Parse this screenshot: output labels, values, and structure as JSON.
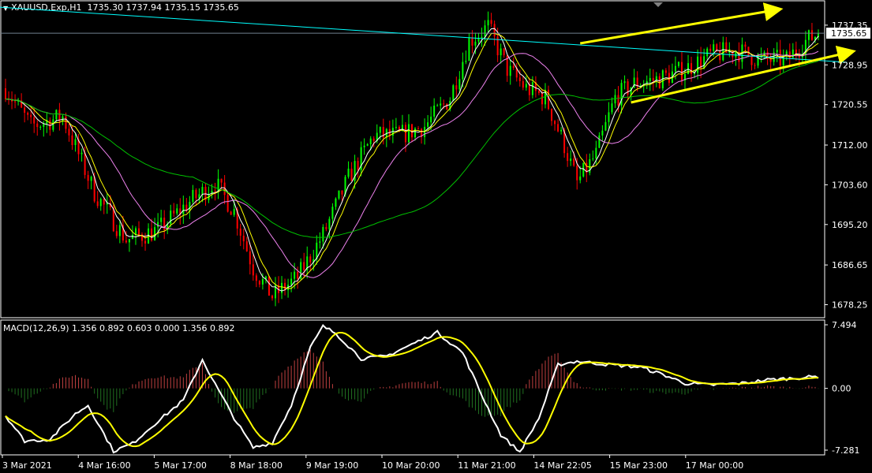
{
  "header": {
    "menu_arrow_icon": "triangle-down-icon",
    "symbol": "XAUUSD.Exp,H1",
    "ohlc": "1735.30 1737.94 1735.15 1735.65"
  },
  "macd": {
    "label": "MACD(12,26,9) 1.356 0.892 0.603 0.000 1.356 0.892"
  },
  "colors": {
    "background": "#000000",
    "frame": "#ffffff",
    "bull_candle": "#00ff00",
    "bear_candle": "#ff0000",
    "ma_fast": "#ffffff",
    "ma_mid": "#ffff00",
    "ma_slow": "#ee82ee",
    "ma_long": "#00c000",
    "trendline": "#00ffff",
    "channel_arrows": "#ffff00",
    "macd_main": "#ffffff",
    "macd_signal": "#ffff00",
    "hist_pos": "#c04040",
    "hist_neg": "#207020"
  },
  "chart_data": [
    {
      "type": "candlestick",
      "timeframe": "H1",
      "price_current": "1735.65",
      "ylim": [
        1675.5,
        1742.5
      ],
      "y_ticks": [
        "1737.35",
        "1728.95",
        "1720.55",
        "1712.00",
        "1703.60",
        "1695.20",
        "1686.65",
        "1678.25"
      ],
      "x_ticks": [
        "3 Mar 2021",
        "4 Mar 16:00",
        "5 Mar 17:00",
        "8 Mar 18:00",
        "9 Mar 19:00",
        "10 Mar 20:00",
        "11 Mar 21:00",
        "14 Mar 22:05",
        "15 Mar 23:00",
        "17 Mar 00:00"
      ],
      "anchors": [
        [
          0,
          1724
        ],
        [
          8,
          1716
        ],
        [
          18,
          1718
        ],
        [
          28,
          1702
        ],
        [
          38,
          1692
        ],
        [
          48,
          1694
        ],
        [
          58,
          1700
        ],
        [
          66,
          1704
        ],
        [
          72,
          1698
        ],
        [
          78,
          1686
        ],
        [
          84,
          1680
        ],
        [
          92,
          1684
        ],
        [
          100,
          1693
        ],
        [
          108,
          1705
        ],
        [
          116,
          1714
        ],
        [
          124,
          1714
        ],
        [
          132,
          1716
        ],
        [
          140,
          1722
        ],
        [
          146,
          1734
        ],
        [
          152,
          1737
        ],
        [
          158,
          1728
        ],
        [
          164,
          1724
        ],
        [
          170,
          1722
        ],
        [
          176,
          1712
        ],
        [
          180,
          1704
        ],
        [
          186,
          1710
        ],
        [
          192,
          1722
        ],
        [
          198,
          1725
        ],
        [
          206,
          1726
        ],
        [
          214,
          1728
        ],
        [
          222,
          1731
        ],
        [
          230,
          1732
        ],
        [
          238,
          1730
        ],
        [
          246,
          1730
        ],
        [
          252,
          1734
        ],
        [
          256,
          1735.65
        ]
      ],
      "trendline": [
        [
          -10,
          1741.5
        ],
        [
          265,
          1729.5
        ]
      ],
      "horizontal_line": 1735.65,
      "arrows": [
        {
          "from": [
            181,
            1733.5
          ],
          "to": [
            242,
            1740.5
          ]
        },
        {
          "from": [
            197,
            1721.0
          ],
          "to": [
            265,
            1731.5
          ]
        }
      ],
      "moving_average_periods": [
        5,
        8,
        21,
        60
      ]
    },
    {
      "type": "macd",
      "params": "12,26,9",
      "ylim": [
        -7.281,
        7.494
      ],
      "y_ticks": [
        "7.494",
        "0.00",
        "-7.281"
      ],
      "anchors": [
        [
          0,
          -3.2
        ],
        [
          6,
          -6.2
        ],
        [
          14,
          -6.0
        ],
        [
          22,
          -3.0
        ],
        [
          26,
          -2.0
        ],
        [
          34,
          -7.4
        ],
        [
          40,
          -6.5
        ],
        [
          46,
          -4.5
        ],
        [
          56,
          -1.4
        ],
        [
          62,
          3.4
        ],
        [
          66,
          0.5
        ],
        [
          72,
          -3.5
        ],
        [
          78,
          -7.0
        ],
        [
          84,
          -6.4
        ],
        [
          90,
          -2.0
        ],
        [
          96,
          4.8
        ],
        [
          100,
          7.3
        ],
        [
          104,
          6.5
        ],
        [
          112,
          3.5
        ],
        [
          120,
          3.8
        ],
        [
          128,
          5.2
        ],
        [
          136,
          6.6
        ],
        [
          144,
          4.2
        ],
        [
          150,
          -0.8
        ],
        [
          156,
          -5.5
        ],
        [
          162,
          -7.5
        ],
        [
          168,
          -3.5
        ],
        [
          174,
          2.8
        ],
        [
          180,
          3.2
        ],
        [
          190,
          2.8
        ],
        [
          200,
          2.5
        ],
        [
          208,
          1.5
        ],
        [
          214,
          0.6
        ],
        [
          222,
          0.4
        ],
        [
          232,
          0.6
        ],
        [
          240,
          1.0
        ],
        [
          256,
          1.4
        ]
      ]
    }
  ]
}
